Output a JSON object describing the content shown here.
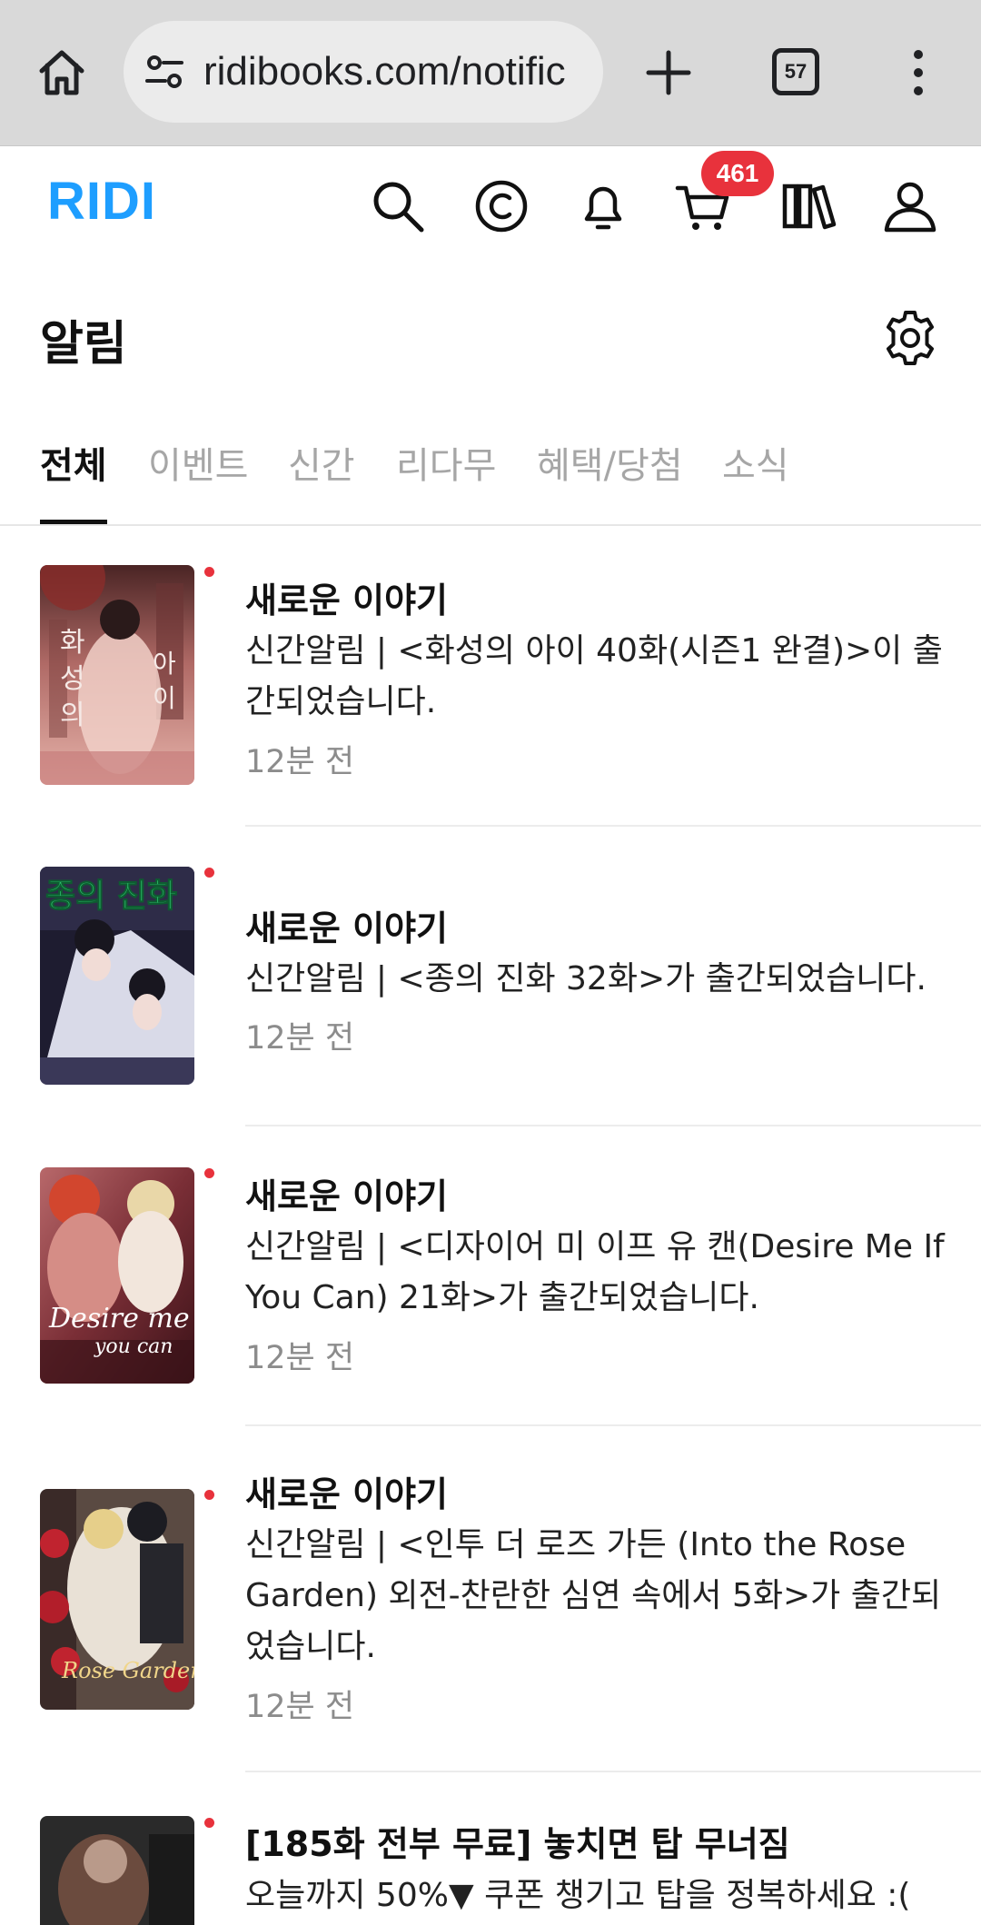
{
  "browser": {
    "url": "ridibooks.com/notific",
    "tab_count": "57"
  },
  "header": {
    "logo": "RIDI",
    "cart_badge": "461"
  },
  "page": {
    "title": "알림"
  },
  "tabs": [
    {
      "label": "전체",
      "active": true
    },
    {
      "label": "이벤트",
      "active": false
    },
    {
      "label": "신간",
      "active": false
    },
    {
      "label": "리다무",
      "active": false
    },
    {
      "label": "혜택/당첨",
      "active": false
    },
    {
      "label": "소식",
      "active": false
    }
  ],
  "notifications": [
    {
      "title": "새로운 이야기",
      "body": "신간알림 | <화성의 아이 40화(시즌1 완결)>이 출\n간되었습니다.",
      "time": "12분 전",
      "cover_text": "화 성 의 아 이",
      "colors": [
        "#5a2a2a",
        "#c98a86",
        "#e7b5ad"
      ]
    },
    {
      "title": "새로운 이야기",
      "body": "신간알림 | <종의 진화 32화>가 출간되었습니다.",
      "time": "12분 전",
      "cover_text": "종의 진화",
      "colors": [
        "#1c1a2e",
        "#cfd0e0",
        "#3e3c5c"
      ]
    },
    {
      "title": "새로운 이야기",
      "body": "신간알림 | <디자이어 미 이프 유 캔(Desire Me If\nYou Can) 21화>가 출간되었습니다.",
      "time": "12분 전",
      "cover_text": "Desire me if you can",
      "colors": [
        "#4a1f26",
        "#c8837e",
        "#e8c6a6"
      ]
    },
    {
      "title": "새로운 이야기",
      "body": "신간알림 | <인투 더 로즈 가든 (Into the Rose\nGarden) 외전-찬란한 심연 속에서 5화>가 출간되\n었습니다.",
      "time": "12분 전",
      "cover_text": "Rose Garden",
      "colors": [
        "#3b1f23",
        "#b8313a",
        "#e3d9cf"
      ]
    },
    {
      "title": "[185화 전부 무료] 놓치면 탑 무너짐",
      "body": "오늘까지 50%▼ 쿠폰 챙기고 탑을 정복하세요 :(",
      "time": "",
      "cover_text": "",
      "colors": [
        "#2a2a2a",
        "#6b4b3e",
        "#b99a8a"
      ]
    }
  ]
}
